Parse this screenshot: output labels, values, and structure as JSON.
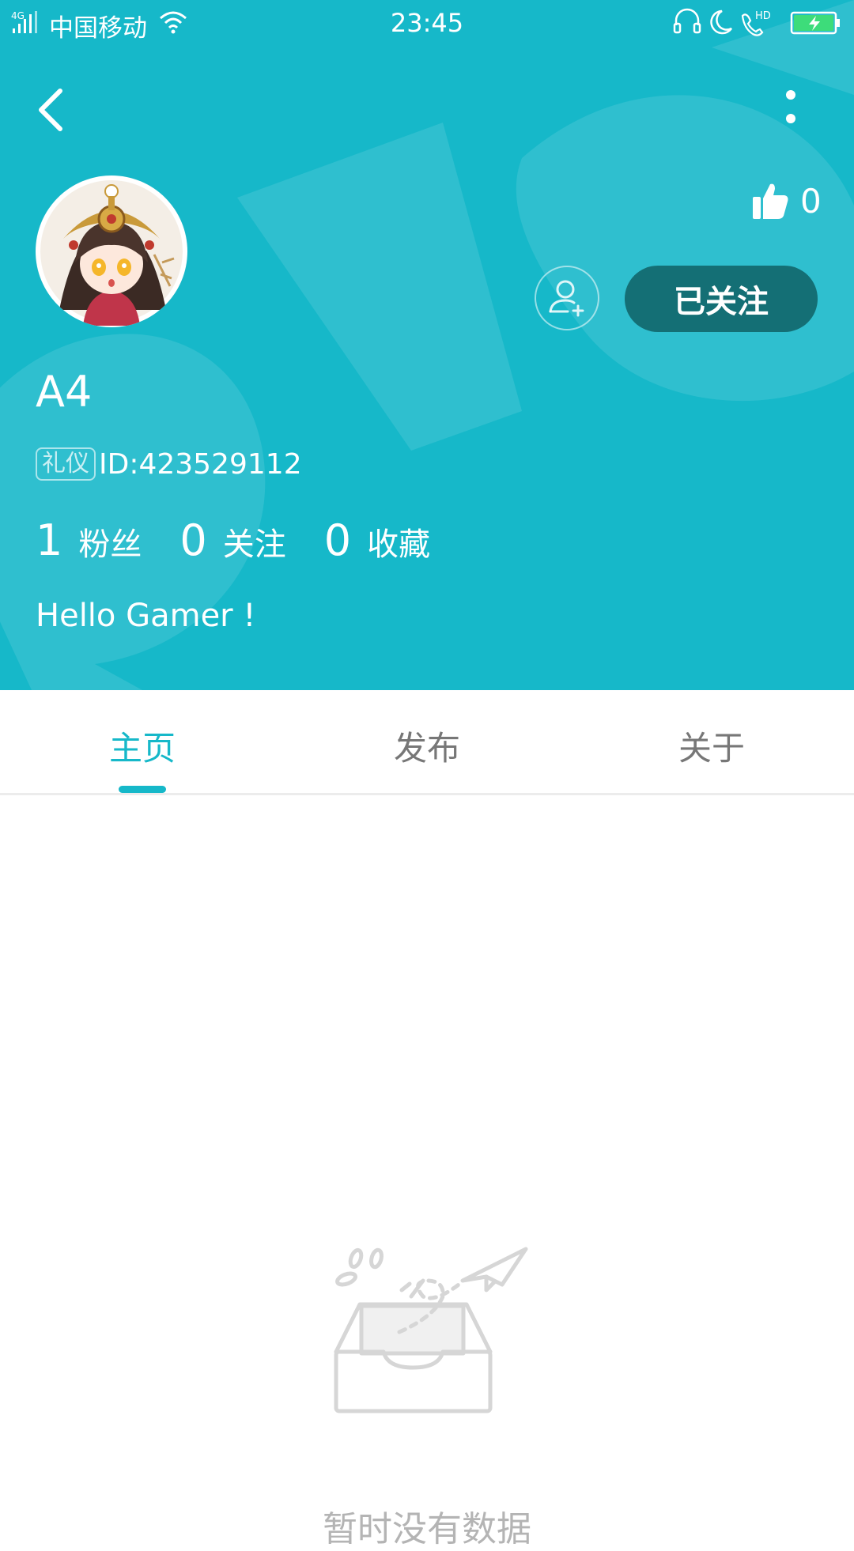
{
  "status_bar": {
    "network": "4G",
    "carrier": "中国移动",
    "time": "23:45",
    "call_badge": "HD"
  },
  "profile": {
    "username": "A4",
    "tag": "礼仪",
    "id_text": "ID:423529112",
    "bio": "Hello Gamer !",
    "likes": "0",
    "follow_button": "已关注",
    "stats": [
      {
        "num": "1",
        "label": "粉丝"
      },
      {
        "num": "0",
        "label": "关注"
      },
      {
        "num": "0",
        "label": "收藏"
      }
    ]
  },
  "tabs": [
    {
      "label": "主页",
      "active": true
    },
    {
      "label": "发布",
      "active": false
    },
    {
      "label": "关于",
      "active": false
    }
  ],
  "empty_state": {
    "message": "暂时没有数据"
  },
  "colors": {
    "header": "#16b8c9",
    "follow_button": "#146f75",
    "accent": "#16b8c9"
  }
}
